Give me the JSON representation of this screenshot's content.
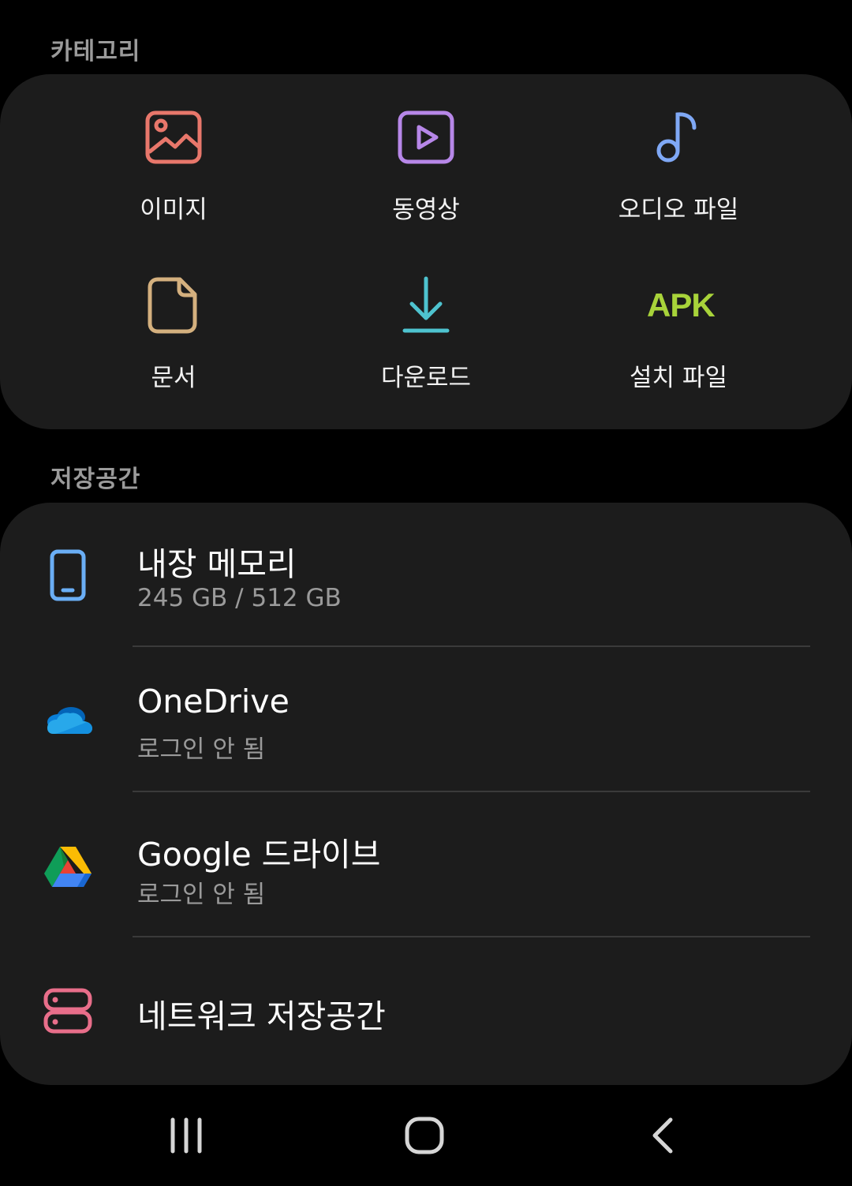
{
  "categories": {
    "header": "카테고리",
    "items": [
      {
        "label": "이미지",
        "icon": "image-icon",
        "color": "#e8776b"
      },
      {
        "label": "동영상",
        "icon": "video-icon",
        "color": "#b787e8"
      },
      {
        "label": "오디오 파일",
        "icon": "music-note-icon",
        "color": "#7fa8f5"
      },
      {
        "label": "문서",
        "icon": "document-icon",
        "color": "#d4b07e"
      },
      {
        "label": "다운로드",
        "icon": "download-icon",
        "color": "#4ec3cf"
      },
      {
        "label": "설치 파일",
        "icon": "apk-icon",
        "icon_text": "APK",
        "color": "#a8d33a"
      }
    ]
  },
  "storage": {
    "header": "저장공간",
    "items": [
      {
        "title": "내장 메모리",
        "subtitle": "245 GB / 512 GB",
        "icon": "phone-icon",
        "color": "#6aaef5"
      },
      {
        "title": "OneDrive",
        "subtitle": "로그인 안 됨",
        "icon": "onedrive-icon"
      },
      {
        "title": "Google 드라이브",
        "subtitle": "로그인 안 됨",
        "icon": "google-drive-icon"
      },
      {
        "title": "네트워크 저장공간",
        "icon": "network-storage-icon",
        "color": "#e86e8a"
      }
    ]
  },
  "nav": {
    "recents": "recents-icon",
    "home": "home-icon",
    "back": "back-icon"
  }
}
